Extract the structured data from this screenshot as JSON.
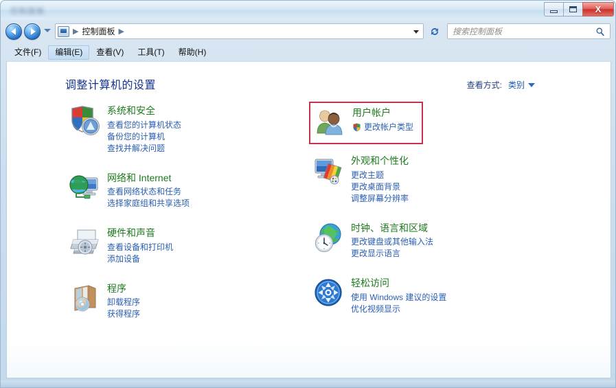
{
  "window": {
    "title_blurred": "控制面板",
    "controls": {
      "minimize": "最小化",
      "maximize": "最大化",
      "close": "X"
    }
  },
  "nav": {
    "back_tooltip": "后退",
    "forward_tooltip": "前进",
    "breadcrumb_root": "控制面板",
    "separator": "▶",
    "refresh": "↻"
  },
  "search": {
    "placeholder": "搜索控制面板",
    "icon": "search-icon"
  },
  "menu": {
    "items": [
      {
        "label": "文件(F)",
        "active": false
      },
      {
        "label": "编辑(E)",
        "active": true
      },
      {
        "label": "查看(V)",
        "active": false
      },
      {
        "label": "工具(T)",
        "active": false
      },
      {
        "label": "帮助(H)",
        "active": false
      }
    ]
  },
  "main": {
    "page_title": "调整计算机的设置",
    "view_by_label": "查看方式:",
    "view_by_value": "类别"
  },
  "categories": {
    "left": [
      {
        "title": "系统和安全",
        "icon": "shield-security-icon",
        "links": [
          "查看您的计算机状态",
          "备份您的计算机",
          "查找并解决问题"
        ]
      },
      {
        "title": "网络和 Internet",
        "icon": "globe-network-icon",
        "links": [
          "查看网络状态和任务",
          "选择家庭组和共享选项"
        ]
      },
      {
        "title": "硬件和声音",
        "icon": "printer-device-icon",
        "links": [
          "查看设备和打印机",
          "添加设备"
        ]
      },
      {
        "title": "程序",
        "icon": "programs-box-icon",
        "links": [
          "卸载程序",
          "获得程序"
        ]
      }
    ],
    "right": [
      {
        "title": "用户帐户",
        "icon": "user-accounts-icon",
        "highlighted": true,
        "links": [
          "更改帐户类型"
        ],
        "link_shield": true
      },
      {
        "title": "外观和个性化",
        "icon": "appearance-monitor-icon",
        "highlighted": false,
        "links": [
          "更改主题",
          "更改桌面背景",
          "调整屏幕分辨率"
        ]
      },
      {
        "title": "时钟、语言和区域",
        "icon": "clock-globe-icon",
        "highlighted": false,
        "links": [
          "更改键盘或其他输入法",
          "更改显示语言"
        ]
      },
      {
        "title": "轻松访问",
        "icon": "ease-of-access-icon",
        "highlighted": false,
        "links": [
          "使用 Windows 建议的设置",
          "优化视频显示"
        ]
      }
    ]
  },
  "colors": {
    "category_title": "#1d7a1d",
    "link": "#2a5fb3",
    "page_title": "#15348c",
    "highlight_box": "#c6314c",
    "close_button": "#c8332c"
  }
}
